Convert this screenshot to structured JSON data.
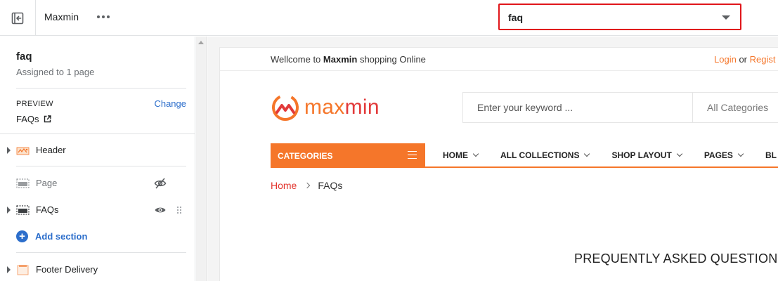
{
  "topbar": {
    "theme_name": "Maxmin",
    "template_select_value": "faq"
  },
  "sidebar": {
    "template_title": "faq",
    "assigned": "Assigned to 1 page",
    "preview_label": "PREVIEW",
    "change_label": "Change",
    "preview_value": "FAQs",
    "sections": [
      {
        "label": "Header",
        "icon": "header-image-icon"
      },
      {
        "label": "Page",
        "icon": "section-placeholder-icon",
        "visibility": "hidden"
      },
      {
        "label": "FAQs",
        "icon": "section-placeholder-icon",
        "visibility": "visible"
      },
      {
        "label": "Footer Delivery",
        "icon": "footer-image-icon"
      }
    ],
    "add_section_label": "Add section"
  },
  "store": {
    "welcome_prefix": "Wellcome to",
    "welcome_brand": "Maxmin",
    "welcome_suffix": "shopping Online",
    "login_label": "Login",
    "or_label": "or",
    "register_label": "Regist",
    "logo_text_part1": "max",
    "logo_text_part2": "min",
    "search_placeholder": "Enter your keyword ...",
    "category_select": "All Categories",
    "categories_button": "CATEGORIES",
    "menu": [
      "HOME",
      "ALL COLLECTIONS",
      "SHOP LAYOUT",
      "PAGES",
      "BL"
    ],
    "breadcrumb_home": "Home",
    "breadcrumb_current": "FAQs",
    "page_heading": "PREQUENTLY ASKED QUESTIONS"
  },
  "colors": {
    "accent_orange": "#f5762a",
    "highlight_red": "#e0161b",
    "link_blue": "#2c6ecb"
  }
}
